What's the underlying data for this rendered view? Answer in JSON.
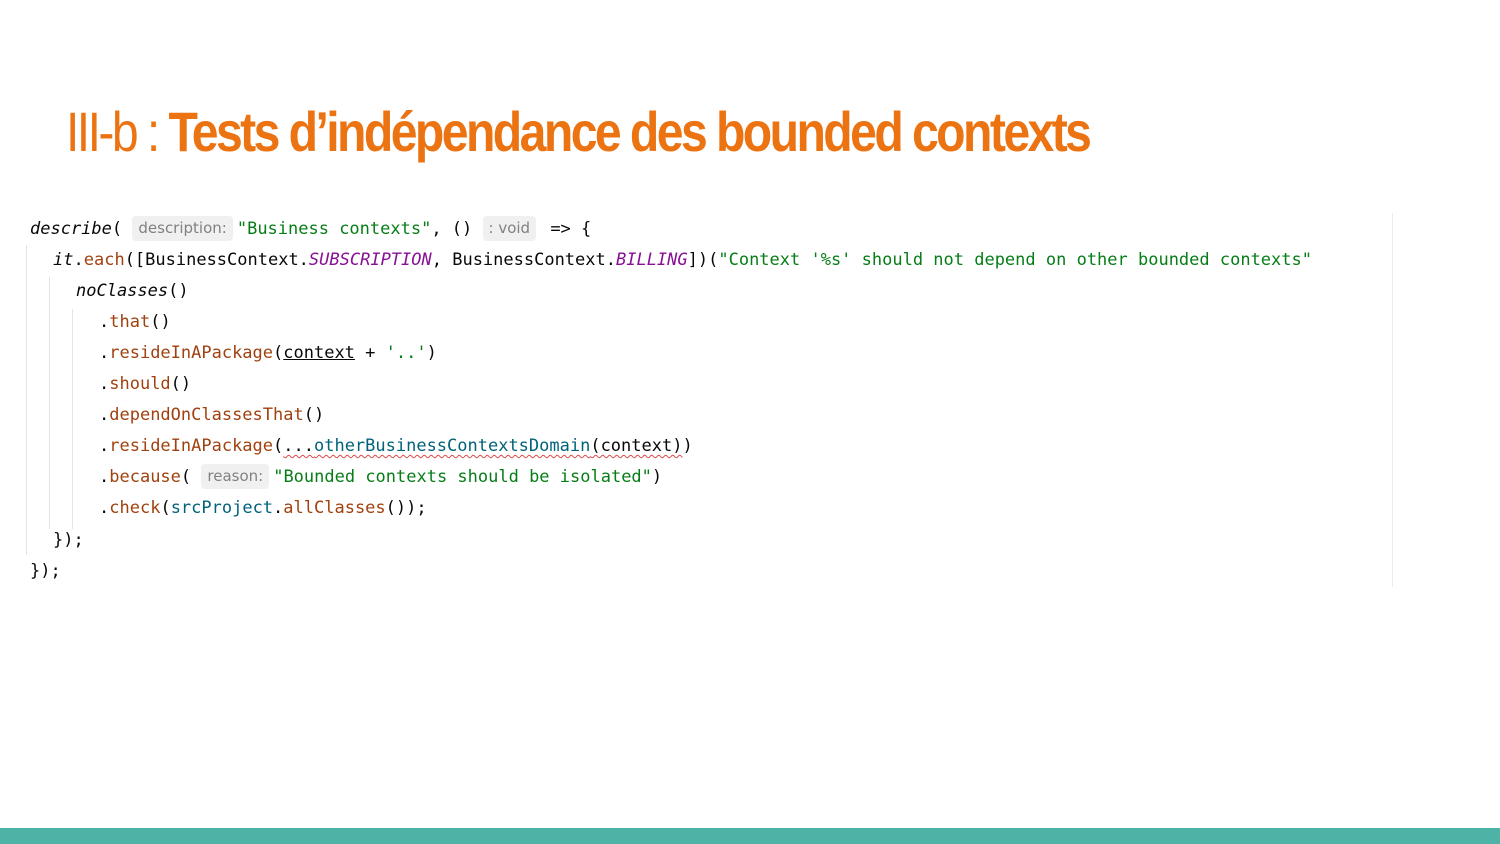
{
  "slide": {
    "title_prefix": "III-b : ",
    "title_main": "Tests d’indépendance des bounded contexts"
  },
  "code": {
    "line1": {
      "fn": "describe",
      "open": "( ",
      "hint": "description:",
      "str": "\"Business contexts\"",
      "mid": ", () ",
      "type_hint": ": void",
      "arrow": " => {"
    },
    "line2": {
      "obj": "it",
      "dot": ".",
      "fn": "each",
      "open": "([BusinessContext.",
      "const1": "SUBSCRIPTION",
      "mid": ", BusinessContext.",
      "const2": "BILLING",
      "close": "])(",
      "str": "\"Context '%s' should not depend on other bounded contexts\""
    },
    "line3": {
      "fn": "noClasses",
      "rest": "()"
    },
    "line4": {
      "dot": ".",
      "meth": "that",
      "rest": "()"
    },
    "line5": {
      "dot": ".",
      "meth": "resideInAPackage",
      "open": "(",
      "arg": "context",
      "op": " + ",
      "str": "'..'",
      "close": ")"
    },
    "line6": {
      "dot": ".",
      "meth": "should",
      "rest": "()"
    },
    "line7": {
      "dot": ".",
      "meth": "dependOnClassesThat",
      "rest": "()"
    },
    "line8": {
      "dot": ".",
      "meth": "resideInAPackage",
      "open": "(",
      "spread": "...",
      "fn": "otherBusinessContextsDomain",
      "args": "(context)",
      "close": ")"
    },
    "line9": {
      "dot": ".",
      "meth": "because",
      "open": "( ",
      "hint": "reason:",
      "str": "\"Bounded contexts should be isolated\"",
      "close": ")"
    },
    "line10": {
      "dot": ".",
      "meth": "check",
      "open": "(",
      "obj": "srcProject",
      "dot2": ".",
      "fn": "allClasses",
      "close": "());"
    },
    "line11": {
      "text": "});"
    },
    "line12": {
      "text": "});"
    }
  },
  "colors": {
    "title_orange": "#ec7311",
    "bottom_bar_teal": "#4db3a6",
    "string_green": "#067d17",
    "function_teal": "#00627a",
    "method_orange": "#a0410f",
    "constant_purple": "#871094"
  }
}
